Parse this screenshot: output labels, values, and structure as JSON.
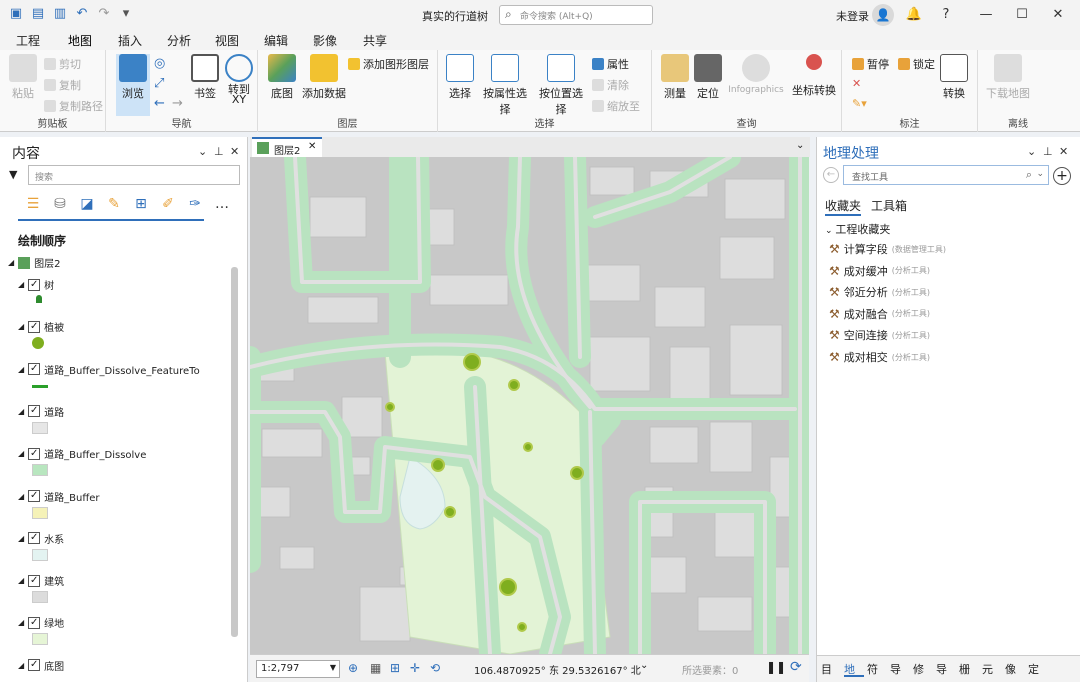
{
  "window": {
    "title": "真实的行道树",
    "search_placeholder": "命令搜索 (Alt+Q)",
    "signin": "未登录"
  },
  "menu": [
    "工程",
    "地图",
    "插入",
    "分析",
    "视图",
    "编辑",
    "影像",
    "共享"
  ],
  "ribbon": {
    "clipboard": {
      "label": "剪贴板",
      "paste": "粘贴",
      "cut": "剪切",
      "copy": "复制",
      "copy_path": "复制路径"
    },
    "navigate": {
      "label": "导航",
      "explore": "浏览",
      "bookmarks": "书签",
      "goto": "转到\nXY"
    },
    "layer": {
      "label": "图层",
      "basemap": "底图",
      "add_data": "添加数据",
      "add_graphics": "添加图形图层"
    },
    "selection": {
      "label": "选择",
      "select": "选择",
      "by_attr": "按属性选择",
      "by_loc": "按位置选择",
      "attributes": "属性",
      "clear": "清除",
      "zoom_to": "缩放至"
    },
    "inquiry": {
      "label": "查询",
      "measure": "测量",
      "locate": "定位",
      "infographics": "Infographics",
      "convert_coord": "坐标转换"
    },
    "labeling": {
      "label": "标注",
      "pause": "暂停",
      "lock": "锁定",
      "convert": "转换"
    },
    "offline": {
      "label": "离线",
      "download": "下载地图"
    }
  },
  "contents": {
    "title": "内容",
    "search_placeholder": "搜索",
    "drawing_order": "绘制顺序",
    "map_name": "图层2",
    "layers": [
      {
        "name": "树",
        "swatch": "tree",
        "color": "#2e8b2e"
      },
      {
        "name": "植被",
        "swatch": "circle",
        "color": "#7fae1f"
      },
      {
        "name": "道路_Buffer_Dissolve_FeatureTo",
        "swatch": "line",
        "color": "#2aa02a"
      },
      {
        "name": "道路",
        "swatch": "rect",
        "color": "#e6e6e6"
      },
      {
        "name": "道路_Buffer_Dissolve",
        "swatch": "rect",
        "color": "#b8e6bf"
      },
      {
        "name": "道路_Buffer",
        "swatch": "rect",
        "color": "#f5f2b8"
      },
      {
        "name": "水系",
        "swatch": "rect",
        "color": "#e3f3f1"
      },
      {
        "name": "建筑",
        "swatch": "rect",
        "color": "#dcdcdc"
      },
      {
        "name": "绿地",
        "swatch": "rect",
        "color": "#e6f5d6"
      },
      {
        "name": "底图",
        "swatch": "none",
        "color": ""
      }
    ]
  },
  "map_view": {
    "tab_label": "图层2",
    "scale": "1:2,797",
    "coordinates": "106.4870925° 东 29.5326167° 北",
    "selected_features": "所选要素：0"
  },
  "geoprocessing": {
    "title": "地理处理",
    "find_placeholder": "查找工具",
    "tabs": [
      "收藏夹",
      "工具箱"
    ],
    "section": "工程收藏夹",
    "tools": [
      {
        "name": "计算字段",
        "toolbox": "(数据管理工具)"
      },
      {
        "name": "成对缓冲",
        "toolbox": "(分析工具)"
      },
      {
        "name": "邻近分析",
        "toolbox": "(分析工具)"
      },
      {
        "name": "成对融合",
        "toolbox": "(分析工具)"
      },
      {
        "name": "空间连接",
        "toolbox": "(分析工具)"
      },
      {
        "name": "成对相交",
        "toolbox": "(分析工具)"
      }
    ],
    "bottom_tabs": [
      "目",
      "地",
      "符",
      "导",
      "修",
      "导",
      "栅",
      "元",
      "像",
      "定"
    ]
  }
}
